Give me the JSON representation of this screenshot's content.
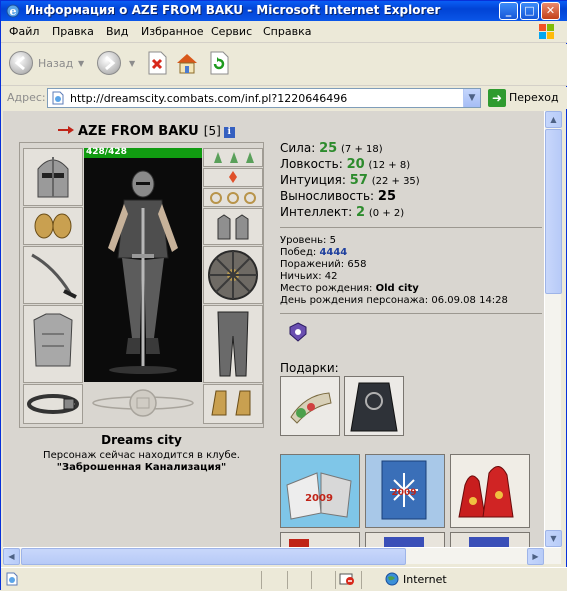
{
  "window": {
    "title": "Информация о AZE FROM BAKU - Microsoft Internet Explorer"
  },
  "menu": {
    "items": [
      "Файл",
      "Правка",
      "Вид",
      "Избранное",
      "Сервис",
      "Справка"
    ]
  },
  "toolbar": {
    "back_label": "Назад"
  },
  "address": {
    "label": "Адрес:",
    "url": "http://dreamscity.combats.com/inf.pl?1220646496",
    "go_label": "Переход"
  },
  "character": {
    "name": "AZE FROM BAKU",
    "level": "[5]",
    "info_glyph": "i",
    "hp": "428/428",
    "city": "Dreams city",
    "club_text": "Персонаж сейчас находится в клубе.",
    "club_location": "\"Заброшенная Канализация\""
  },
  "stats": [
    {
      "label": "Сила:",
      "value": "25",
      "bonus": "(7 + 18)",
      "color": "green"
    },
    {
      "label": "Ловкость:",
      "value": "20",
      "bonus": "(12 + 8)",
      "color": "green"
    },
    {
      "label": "Интуиция:",
      "value": "57",
      "bonus": "(22 + 35)",
      "color": "green"
    },
    {
      "label": "Выносливость:",
      "value": "25",
      "bonus": "",
      "color": "black"
    },
    {
      "label": "Интеллект:",
      "value": "2",
      "bonus": "(0 + 2)",
      "color": "green"
    }
  ],
  "info": {
    "level_label": "Уровень:",
    "level_value": "5",
    "wins_label": "Побед:",
    "wins_value": "4444",
    "losses_label": "Поражений:",
    "losses_value": "658",
    "draws_label": "Ничьих:",
    "draws_value": "42",
    "birthplace_label": "Место рождения:",
    "birthplace_value": "Old city",
    "birthday_label": "День рождения персонажа:",
    "birthday_value": "06.09.08 14:28"
  },
  "gifts": {
    "label": "Подарки:",
    "card_year": "2009"
  },
  "status": {
    "zone": "Internet"
  },
  "colors": {
    "title_bar": "#0143D5",
    "stat_green": "#2D8B2D",
    "hp_bar": "#119B11",
    "wins_blue": "#1E3F9E",
    "content_bg": "#D9D6D0"
  },
  "icons": [
    "ie-icon",
    "minimize-icon",
    "maximize-icon",
    "close-icon",
    "windows-logo-icon",
    "back-icon",
    "forward-icon",
    "stop-icon",
    "home-icon",
    "refresh-icon",
    "page-icon",
    "go-arrow-icon",
    "red-arrow-icon",
    "info-icon",
    "clan-badge-icon",
    "zone-globe-icon",
    "popup-blocked-icon"
  ]
}
